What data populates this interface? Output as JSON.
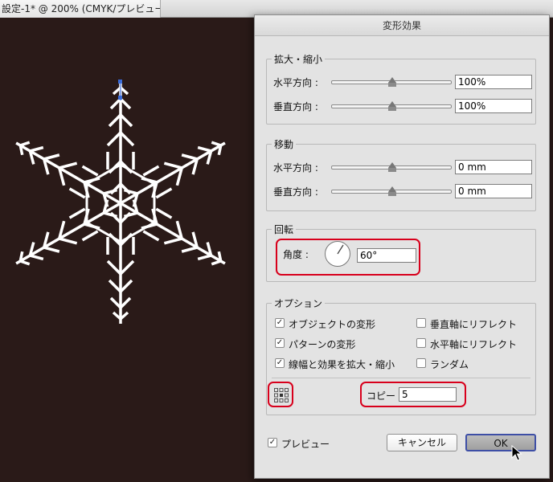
{
  "document": {
    "tab_title": "設定-1* @ 200% (CMYK/プレビュー)"
  },
  "dialog": {
    "title": "変形効果",
    "scale": {
      "label": "拡大・縮小",
      "horizontal_label": "水平方向 :",
      "horizontal_value": "100%",
      "vertical_label": "垂直方向 :",
      "vertical_value": "100%"
    },
    "move": {
      "label": "移動",
      "horizontal_label": "水平方向 :",
      "horizontal_value": "0 mm",
      "vertical_label": "垂直方向 :",
      "vertical_value": "0 mm"
    },
    "rotate": {
      "label": "回転",
      "angle_label": "角度 :",
      "angle_value": "60°"
    },
    "options": {
      "label": "オプション",
      "transform_objects": "オブジェクトの変形",
      "transform_patterns": "パターンの変形",
      "scale_strokes": "線幅と効果を拡大・縮小",
      "reflect_x": "垂直軸にリフレクト",
      "reflect_y": "水平軸にリフレクト",
      "random": "ランダム",
      "check_mark": "✓",
      "copies_label": "コピー",
      "copies_value": "5"
    },
    "preview_label": "プレビュー",
    "cancel_label": "キャンセル",
    "ok_label": "OK"
  },
  "colors": {
    "canvas_bg": "#2a1a18",
    "highlight": "#d8001c",
    "ok_border": "#3e4fa6",
    "snowflake": "#ffffff",
    "anchor": "#3a6bd8"
  }
}
